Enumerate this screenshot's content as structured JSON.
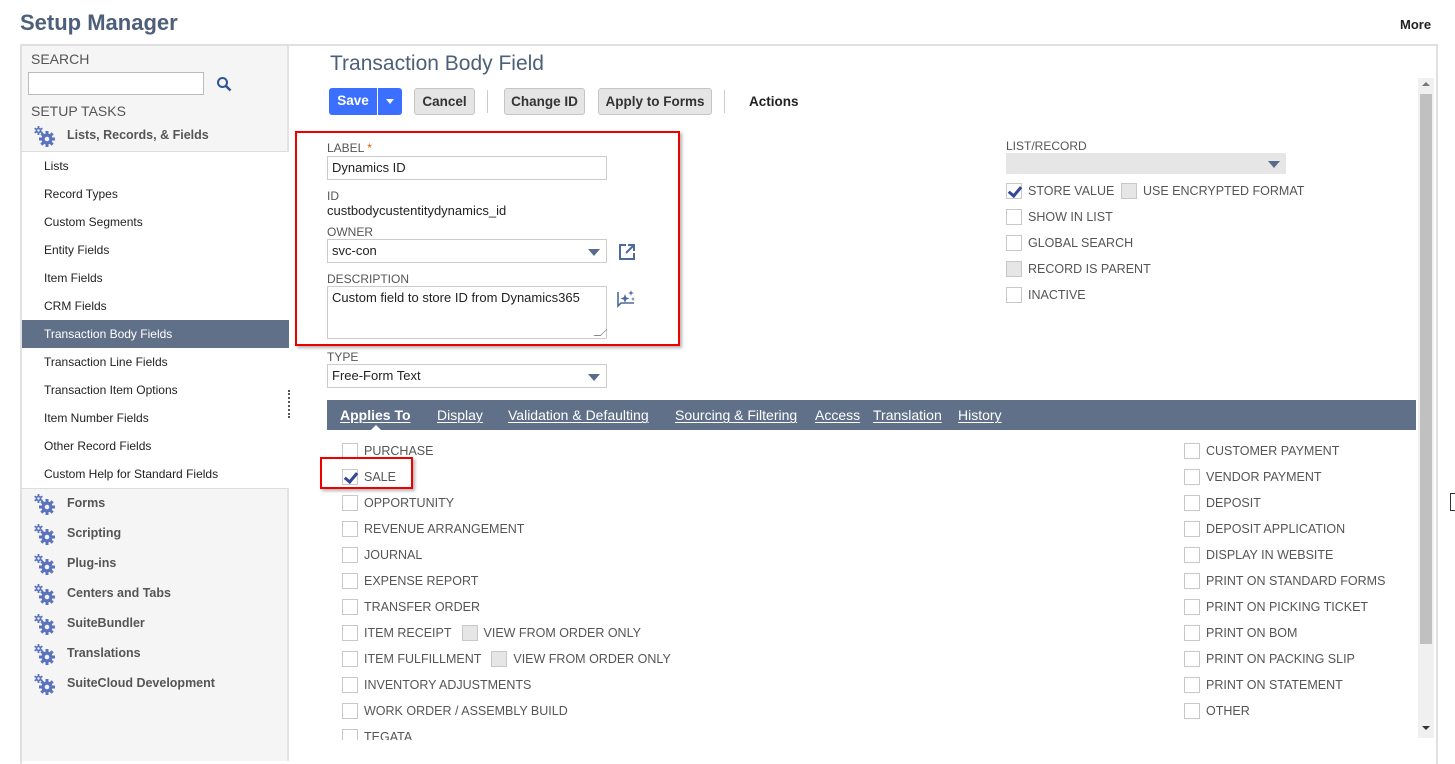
{
  "header": {
    "app_title": "Setup Manager",
    "more_label": "More"
  },
  "sidebar": {
    "search_label": "SEARCH",
    "search_value": "",
    "setup_tasks_label": "SETUP TASKS",
    "expanded_group": "Lists, Records, & Fields",
    "sub_items": [
      {
        "label": "Lists",
        "active": false
      },
      {
        "label": "Record Types",
        "active": false
      },
      {
        "label": "Custom Segments",
        "active": false
      },
      {
        "label": "Entity Fields",
        "active": false
      },
      {
        "label": "Item Fields",
        "active": false
      },
      {
        "label": "CRM Fields",
        "active": false
      },
      {
        "label": "Transaction Body Fields",
        "active": true
      },
      {
        "label": "Transaction Line Fields",
        "active": false
      },
      {
        "label": "Transaction Item Options",
        "active": false
      },
      {
        "label": "Item Number Fields",
        "active": false
      },
      {
        "label": "Other Record Fields",
        "active": false
      },
      {
        "label": "Custom Help for Standard Fields",
        "active": false
      }
    ],
    "groups": [
      "Forms",
      "Scripting",
      "Plug-ins",
      "Centers and Tabs",
      "SuiteBundler",
      "Translations",
      "SuiteCloud Development"
    ]
  },
  "main": {
    "title": "Transaction Body Field",
    "toolbar": {
      "save": "Save",
      "cancel": "Cancel",
      "change_id": "Change ID",
      "apply_to_forms": "Apply to Forms",
      "actions": "Actions"
    },
    "fields": {
      "label_label": "LABEL",
      "required_mark": "*",
      "label_value": "Dynamics ID",
      "id_label": "ID",
      "id_value": "custbodycustentitydynamics_id",
      "owner_label": "OWNER",
      "owner_value": "svc-con",
      "description_label": "DESCRIPTION",
      "description_value": "Custom field to store ID from Dynamics365",
      "type_label": "TYPE",
      "type_value": "Free-Form Text",
      "list_record_label": "LIST/RECORD",
      "list_record_value": ""
    },
    "options": [
      {
        "label": "STORE VALUE",
        "checked": true
      },
      {
        "label": "USE ENCRYPTED FORMAT",
        "checked": false,
        "disabled": true
      },
      {
        "label": "SHOW IN LIST",
        "checked": false
      },
      {
        "label": "GLOBAL SEARCH",
        "checked": false
      },
      {
        "label": "RECORD IS PARENT",
        "checked": false,
        "disabled": true
      },
      {
        "label": "INACTIVE",
        "checked": false
      }
    ],
    "tabs": [
      {
        "label": "Applies To",
        "active": true
      },
      {
        "label": "Display",
        "active": false
      },
      {
        "label": "Validation & Defaulting",
        "active": false
      },
      {
        "label": "Sourcing & Filtering",
        "active": false
      },
      {
        "label": "Access",
        "active": false
      },
      {
        "label": "Translation",
        "active": false
      },
      {
        "label": "History",
        "active": false
      }
    ],
    "applies_left": [
      {
        "label": "PURCHASE",
        "checked": false
      },
      {
        "label": "SALE",
        "checked": true
      },
      {
        "label": "OPPORTUNITY",
        "checked": false
      },
      {
        "label": "REVENUE ARRANGEMENT",
        "checked": false
      },
      {
        "label": "JOURNAL",
        "checked": false
      },
      {
        "label": "EXPENSE REPORT",
        "checked": false
      },
      {
        "label": "TRANSFER ORDER",
        "checked": false
      },
      {
        "label": "ITEM RECEIPT",
        "checked": false,
        "sub": "VIEW FROM ORDER ONLY"
      },
      {
        "label": "ITEM FULFILLMENT",
        "checked": false,
        "sub": "VIEW FROM ORDER ONLY"
      },
      {
        "label": "INVENTORY ADJUSTMENTS",
        "checked": false
      },
      {
        "label": "WORK ORDER / ASSEMBLY BUILD",
        "checked": false
      },
      {
        "label": "TEGATA",
        "checked": false
      }
    ],
    "applies_right": [
      {
        "label": "CUSTOMER PAYMENT",
        "checked": false
      },
      {
        "label": "VENDOR PAYMENT",
        "checked": false
      },
      {
        "label": "DEPOSIT",
        "checked": false
      },
      {
        "label": "DEPOSIT APPLICATION",
        "checked": false
      },
      {
        "label": "DISPLAY IN WEBSITE",
        "checked": false
      },
      {
        "label": "PRINT ON STANDARD FORMS",
        "checked": false
      },
      {
        "label": "PRINT ON PICKING TICKET",
        "checked": false
      },
      {
        "label": "PRINT ON BOM",
        "checked": false
      },
      {
        "label": "PRINT ON PACKING SLIP",
        "checked": false
      },
      {
        "label": "PRINT ON STATEMENT",
        "checked": false
      },
      {
        "label": "OTHER",
        "checked": false
      }
    ]
  }
}
